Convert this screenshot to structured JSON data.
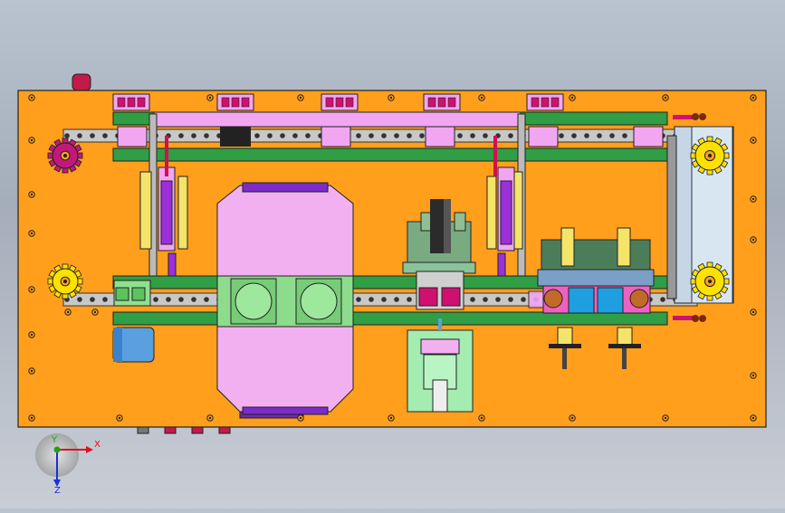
{
  "viewport": {
    "background_top": "#b9c2cf",
    "background_bottom": "#c9ced6"
  },
  "colors": {
    "base_plate": "#ff9f1c",
    "outline": "#2a2a2a",
    "rail_green": "#2f9e44",
    "chain": "#c8c8c8",
    "fixture_pink": "#f2a6f2",
    "sprocket_yellow": "#ffe100",
    "sprocket_magenta": "#c2187a",
    "rod_purple": "#9b30d9",
    "cylinder_yellow": "#f5e46a",
    "fixture_light_green": "#90e0a0",
    "steel_blue": "#5aa0e0",
    "panel_blue_grey": "#c6d6e6",
    "x_axis_red": "#e0101c",
    "y_axis_green": "#1ea01e",
    "z_axis_blue": "#1a2fd6"
  },
  "triad": {
    "x_label": "X",
    "y_label": "Y",
    "z_label": "Z"
  },
  "icons": {
    "drive_sprocket": "sprocket-icon",
    "idler_sprocket": "sprocket-icon",
    "coordinate_triad": "axis-triad-icon"
  }
}
